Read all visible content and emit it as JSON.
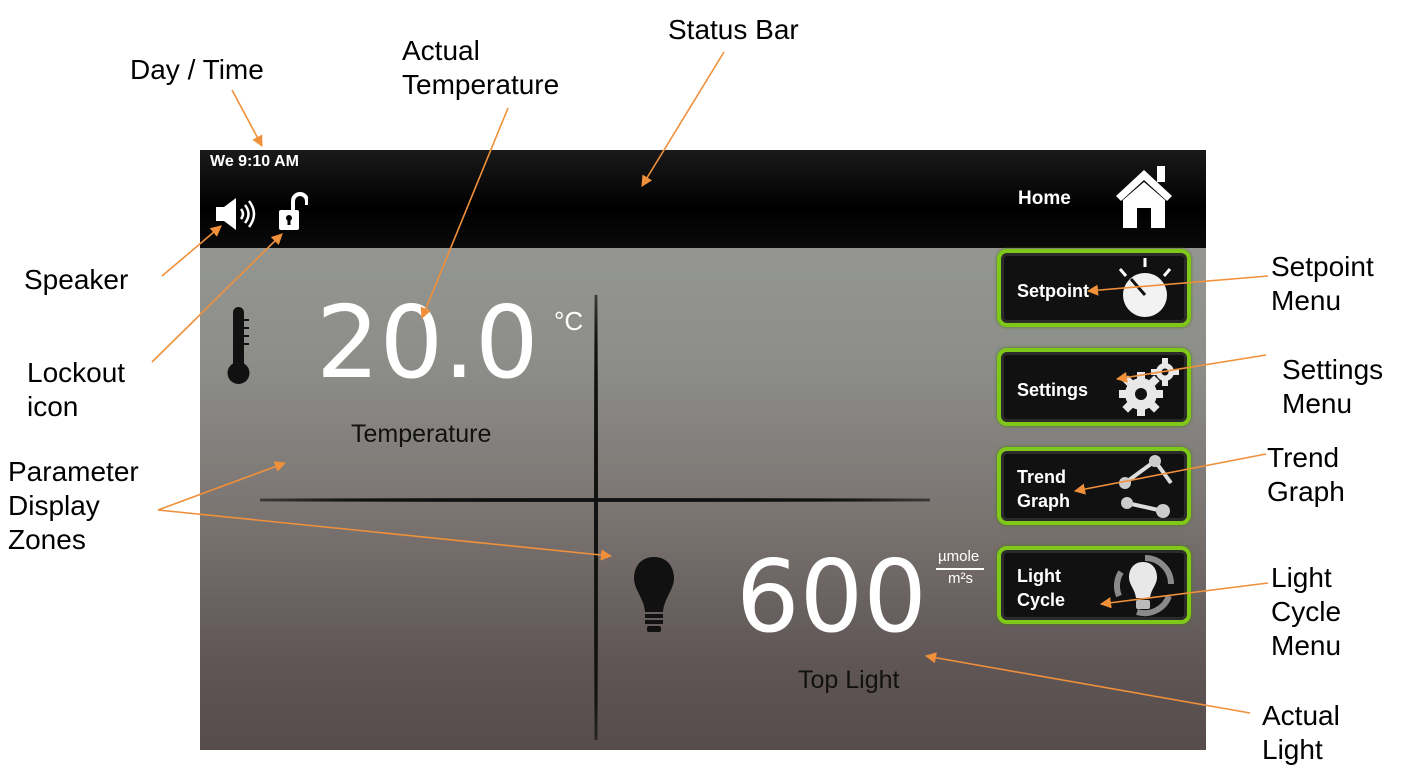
{
  "callouts": {
    "day_time": "Day / Time",
    "actual_temperature": "Actual\nTemperature",
    "status_bar": "Status Bar",
    "speaker": "Speaker",
    "lockout_icon": "Lockout\nicon",
    "parameter_display_zones": "Parameter\nDisplay\nZones",
    "setpoint_menu": "Setpoint\nMenu",
    "settings_menu": "Settings\nMenu",
    "trend_graph": "Trend\nGraph",
    "light_cycle_menu": "Light\nCycle\nMenu",
    "actual_light": "Actual\nLight"
  },
  "status_bar": {
    "day_time": "We 9:10 AM",
    "home_label": "Home",
    "speaker_icon": "speaker-icon",
    "lock_icon": "unlocked-padlock-icon",
    "home_icon": "house-icon"
  },
  "temperature": {
    "value": "20.0",
    "unit": "°C",
    "label": "Temperature",
    "icon": "thermometer-icon"
  },
  "light": {
    "value": "600",
    "unit_numerator": "µmole",
    "unit_denominator": "m²s",
    "label": "Top Light",
    "icon": "light-bulb-icon"
  },
  "menu": {
    "setpoint": "Setpoint",
    "settings": "Settings",
    "trend_graph": "Trend\nGraph",
    "light_cycle": "Light\nCycle"
  },
  "colors": {
    "button_border": "#7fc81a",
    "callout_arrow": "#f0903a",
    "status_bar": "#000000"
  }
}
